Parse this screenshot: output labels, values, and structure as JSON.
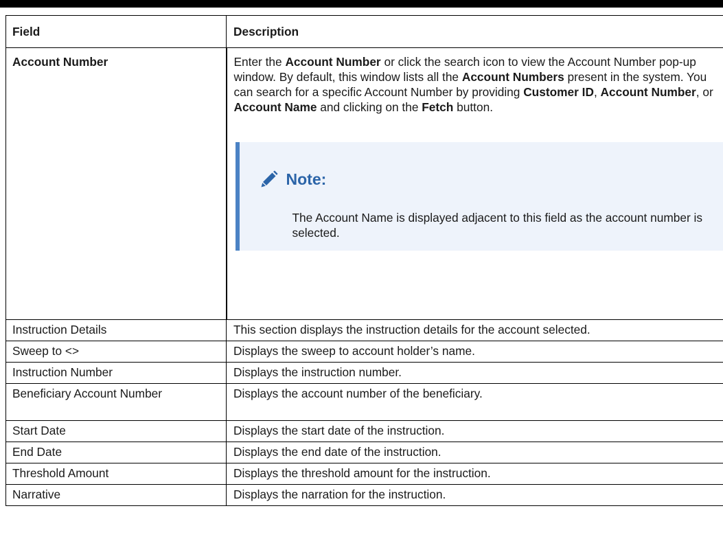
{
  "table": {
    "headers": {
      "field": "Field",
      "description": "Description"
    },
    "account_number": {
      "field": "Account Number",
      "description": {
        "part1": "Enter the ",
        "bold1": "Account Number",
        "part2": " or click the search icon to view the Account Number pop-up window. By default, this window lists all the ",
        "bold2": "Account Numbers",
        "part3": " present in the system. You can search for a specific Account Number by providing ",
        "bold3": "Customer ID",
        "part4": ", ",
        "bold4": "Account Number",
        "part5": ", or ",
        "bold5": "Account Name",
        "part6": " and clicking on the ",
        "bold6": "Fetch",
        "part7": " button."
      },
      "note": {
        "icon": "pencil-icon",
        "title": "Note:",
        "text": "The Account Name is displayed adjacent to this field as the account number is selected."
      }
    },
    "rows": [
      {
        "field": "Instruction Details",
        "description": "This section displays the instruction details for the account selected."
      },
      {
        "field": "Sweep to <>",
        "description": "Displays the sweep to account holder’s name."
      },
      {
        "field": "Instruction Number",
        "description": "Displays the instruction number."
      },
      {
        "field": "Beneficiary Account Number",
        "description": "Displays the account number of the beneficiary."
      },
      {
        "field": "Start Date",
        "description": "Displays the start date of the instruction."
      },
      {
        "field": "End Date",
        "description": "Displays the end date of the instruction."
      },
      {
        "field": "Threshold Amount",
        "description": "Displays the threshold amount for the instruction."
      },
      {
        "field": "Narrative",
        "description": "Displays the narration for the instruction."
      }
    ]
  },
  "colors": {
    "note_accent": "#4b82c4",
    "note_bg": "#eef3fb",
    "note_title": "#2b64a8"
  }
}
